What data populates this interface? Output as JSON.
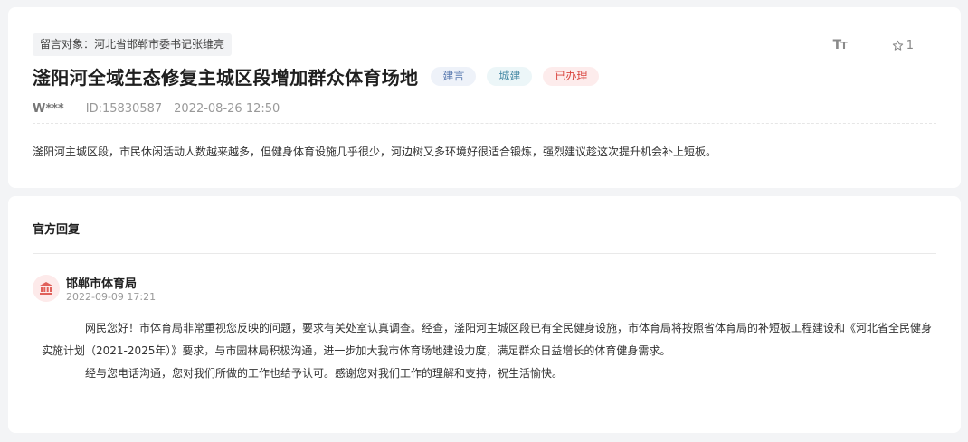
{
  "message": {
    "target": "留言对象：河北省邯郸市委书记张维亮",
    "title": "滏阳河全域生态修复主城区段增加群众体育场地",
    "tags": [
      "建言",
      "城建",
      "已办理"
    ],
    "author": "W***",
    "id": "ID:15830587",
    "date": "2022-08-26 12:50",
    "content": "滏阳河主城区段，市民休闲活动人数越来越多，但健身体育设施几乎很少，河边树又多环境好很适合锻炼，强烈建议趁这次提升机会补上短板。",
    "font_size_icon": "font-size-icon",
    "favorite_icon": "star-icon",
    "favorite_count": "1"
  },
  "reply": {
    "section_title": "官方回复",
    "org_icon": "government-building-icon",
    "org_name": "邯郸市体育局",
    "date": "2022-09-09 17:21",
    "paragraph_1": "网民您好！市体育局非常重视您反映的问题，要求有关处室认真调查。经查，滏阳河主城区段已有全民健身设施，市体育局将按照省体育局的补短板工程建设和《河北省全民健身实施计划（2021-2025年）》要求，与市园林局积极沟通，进一步加大我市体育场地建设力度，满足群众日益增长的体育健身需求。",
    "paragraph_2": "经与您电话沟通，您对我们所做的工作也给予认可。感谢您对我们工作的理解和支持，祝生活愉快。"
  },
  "colors": {
    "page_bg": "#f3f4f6",
    "tag_jianyan": "#5b7bb0",
    "tag_chengjian": "#4a8ca6",
    "tag_done": "#d9443e",
    "avatar_bg": "#fdeaea",
    "avatar_icon": "#e0605a"
  }
}
